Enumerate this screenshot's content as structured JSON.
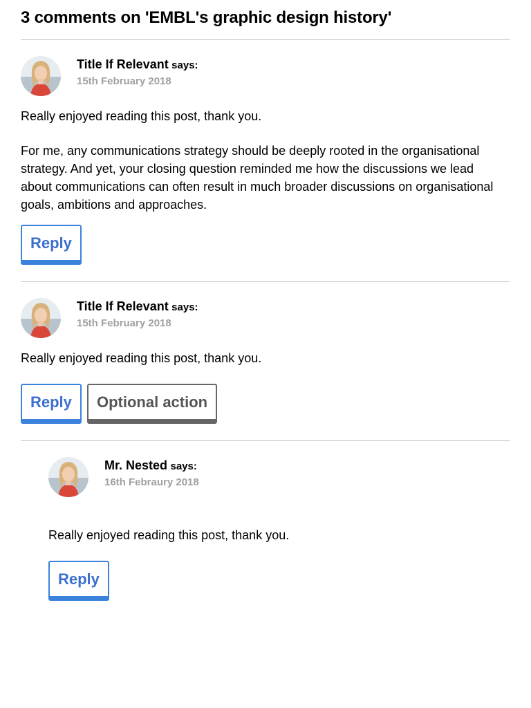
{
  "header": {
    "title": "3 comments on 'EMBL's graphic design history'"
  },
  "comments": [
    {
      "author": "Title If Relevant",
      "says": "says:",
      "date": "15th February 2018",
      "paragraphs": [
        "Really enjoyed reading this post, thank you.",
        "For me, any communications strategy should be deeply rooted in the organisational strategy. And yet, your closing question reminded me how the discussions we lead about communications can often result in much broader discussions on organisational goals, ambitions and approaches."
      ],
      "reply_label": "Reply"
    },
    {
      "author": "Title If Relevant",
      "says": "says:",
      "date": "15th February 2018",
      "paragraphs": [
        "Really enjoyed reading this post, thank you."
      ],
      "reply_label": "Reply",
      "optional_label": "Optional action"
    },
    {
      "author": "Mr. Nested",
      "says": "says:",
      "date": "16th Febraury 2018",
      "paragraphs": [
        "Really enjoyed reading this post, thank you."
      ],
      "reply_label": "Reply"
    }
  ],
  "colors": {
    "primary": "#3b82dc",
    "secondary": "#666666",
    "date": "#a0a0a0",
    "divider": "#c6c6c6"
  }
}
